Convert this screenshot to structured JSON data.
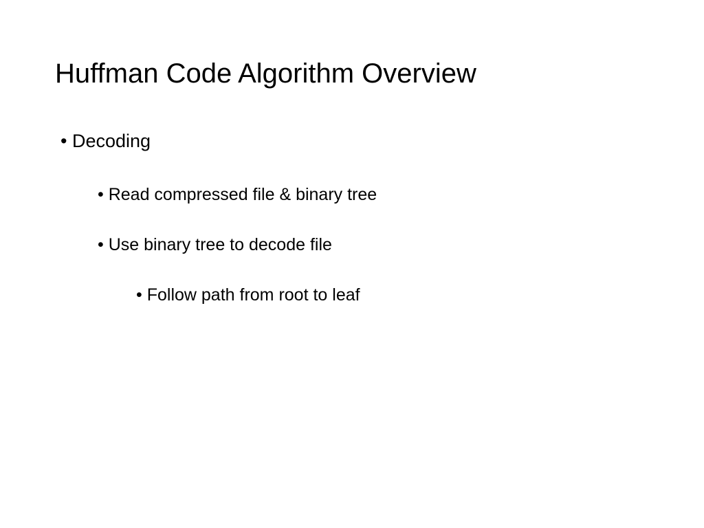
{
  "slide": {
    "title": "Huffman Code Algorithm Overview",
    "bullets": {
      "level1_item1": "Decoding",
      "level2_item1": "Read compressed file & binary tree",
      "level2_item2": "Use binary tree to decode file",
      "level3_item1": "Follow path from root to leaf"
    },
    "bullet_char": "•"
  }
}
